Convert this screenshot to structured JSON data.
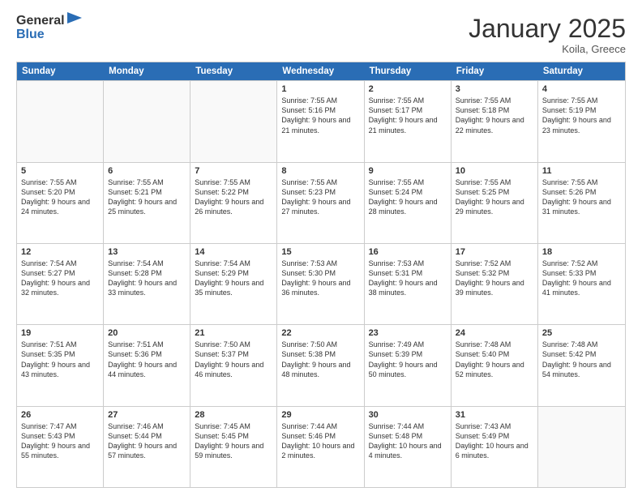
{
  "header": {
    "logo": {
      "general": "General",
      "blue": "Blue"
    },
    "title": "January 2025",
    "location": "Koila, Greece"
  },
  "weekdays": [
    "Sunday",
    "Monday",
    "Tuesday",
    "Wednesday",
    "Thursday",
    "Friday",
    "Saturday"
  ],
  "weeks": [
    [
      {
        "day": "",
        "empty": true
      },
      {
        "day": "",
        "empty": true
      },
      {
        "day": "",
        "empty": true
      },
      {
        "day": "1",
        "sunrise": "7:55 AM",
        "sunset": "5:16 PM",
        "daylight": "9 hours and 21 minutes."
      },
      {
        "day": "2",
        "sunrise": "7:55 AM",
        "sunset": "5:17 PM",
        "daylight": "9 hours and 21 minutes."
      },
      {
        "day": "3",
        "sunrise": "7:55 AM",
        "sunset": "5:18 PM",
        "daylight": "9 hours and 22 minutes."
      },
      {
        "day": "4",
        "sunrise": "7:55 AM",
        "sunset": "5:19 PM",
        "daylight": "9 hours and 23 minutes."
      }
    ],
    [
      {
        "day": "5",
        "sunrise": "7:55 AM",
        "sunset": "5:20 PM",
        "daylight": "9 hours and 24 minutes."
      },
      {
        "day": "6",
        "sunrise": "7:55 AM",
        "sunset": "5:21 PM",
        "daylight": "9 hours and 25 minutes."
      },
      {
        "day": "7",
        "sunrise": "7:55 AM",
        "sunset": "5:22 PM",
        "daylight": "9 hours and 26 minutes."
      },
      {
        "day": "8",
        "sunrise": "7:55 AM",
        "sunset": "5:23 PM",
        "daylight": "9 hours and 27 minutes."
      },
      {
        "day": "9",
        "sunrise": "7:55 AM",
        "sunset": "5:24 PM",
        "daylight": "9 hours and 28 minutes."
      },
      {
        "day": "10",
        "sunrise": "7:55 AM",
        "sunset": "5:25 PM",
        "daylight": "9 hours and 29 minutes."
      },
      {
        "day": "11",
        "sunrise": "7:55 AM",
        "sunset": "5:26 PM",
        "daylight": "9 hours and 31 minutes."
      }
    ],
    [
      {
        "day": "12",
        "sunrise": "7:54 AM",
        "sunset": "5:27 PM",
        "daylight": "9 hours and 32 minutes."
      },
      {
        "day": "13",
        "sunrise": "7:54 AM",
        "sunset": "5:28 PM",
        "daylight": "9 hours and 33 minutes."
      },
      {
        "day": "14",
        "sunrise": "7:54 AM",
        "sunset": "5:29 PM",
        "daylight": "9 hours and 35 minutes."
      },
      {
        "day": "15",
        "sunrise": "7:53 AM",
        "sunset": "5:30 PM",
        "daylight": "9 hours and 36 minutes."
      },
      {
        "day": "16",
        "sunrise": "7:53 AM",
        "sunset": "5:31 PM",
        "daylight": "9 hours and 38 minutes."
      },
      {
        "day": "17",
        "sunrise": "7:52 AM",
        "sunset": "5:32 PM",
        "daylight": "9 hours and 39 minutes."
      },
      {
        "day": "18",
        "sunrise": "7:52 AM",
        "sunset": "5:33 PM",
        "daylight": "9 hours and 41 minutes."
      }
    ],
    [
      {
        "day": "19",
        "sunrise": "7:51 AM",
        "sunset": "5:35 PM",
        "daylight": "9 hours and 43 minutes."
      },
      {
        "day": "20",
        "sunrise": "7:51 AM",
        "sunset": "5:36 PM",
        "daylight": "9 hours and 44 minutes."
      },
      {
        "day": "21",
        "sunrise": "7:50 AM",
        "sunset": "5:37 PM",
        "daylight": "9 hours and 46 minutes."
      },
      {
        "day": "22",
        "sunrise": "7:50 AM",
        "sunset": "5:38 PM",
        "daylight": "9 hours and 48 minutes."
      },
      {
        "day": "23",
        "sunrise": "7:49 AM",
        "sunset": "5:39 PM",
        "daylight": "9 hours and 50 minutes."
      },
      {
        "day": "24",
        "sunrise": "7:48 AM",
        "sunset": "5:40 PM",
        "daylight": "9 hours and 52 minutes."
      },
      {
        "day": "25",
        "sunrise": "7:48 AM",
        "sunset": "5:42 PM",
        "daylight": "9 hours and 54 minutes."
      }
    ],
    [
      {
        "day": "26",
        "sunrise": "7:47 AM",
        "sunset": "5:43 PM",
        "daylight": "9 hours and 55 minutes."
      },
      {
        "day": "27",
        "sunrise": "7:46 AM",
        "sunset": "5:44 PM",
        "daylight": "9 hours and 57 minutes."
      },
      {
        "day": "28",
        "sunrise": "7:45 AM",
        "sunset": "5:45 PM",
        "daylight": "9 hours and 59 minutes."
      },
      {
        "day": "29",
        "sunrise": "7:44 AM",
        "sunset": "5:46 PM",
        "daylight": "10 hours and 2 minutes."
      },
      {
        "day": "30",
        "sunrise": "7:44 AM",
        "sunset": "5:48 PM",
        "daylight": "10 hours and 4 minutes."
      },
      {
        "day": "31",
        "sunrise": "7:43 AM",
        "sunset": "5:49 PM",
        "daylight": "10 hours and 6 minutes."
      },
      {
        "day": "",
        "empty": true
      }
    ]
  ]
}
